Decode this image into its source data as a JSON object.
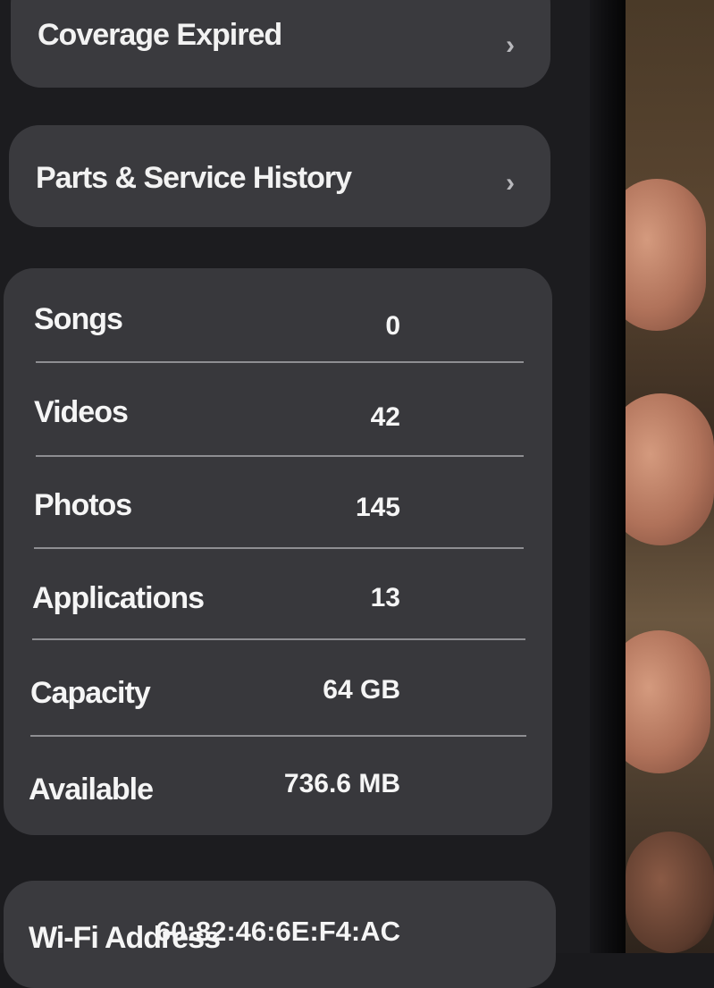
{
  "links": {
    "coverage": {
      "label": "Coverage Expired",
      "icon": "chevron-right-icon"
    },
    "parts": {
      "label": "Parts & Service History",
      "icon": "chevron-right-icon"
    }
  },
  "stats": [
    {
      "label": "Songs",
      "value": "0"
    },
    {
      "label": "Videos",
      "value": "42"
    },
    {
      "label": "Photos",
      "value": "145"
    },
    {
      "label": "Applications",
      "value": "13"
    },
    {
      "label": "Capacity",
      "value": "64 GB"
    },
    {
      "label": "Available",
      "value": "736.6 MB"
    }
  ],
  "network": {
    "wifi_label": "Wi-Fi Address",
    "wifi_value": "60:82:46:6E:F4:AC"
  },
  "chevron_glyph": "›",
  "colors": {
    "background": "#1c1c1f",
    "card": "#3a3a3e",
    "text": "#f5f5f5",
    "divider": "#8e8e92"
  }
}
